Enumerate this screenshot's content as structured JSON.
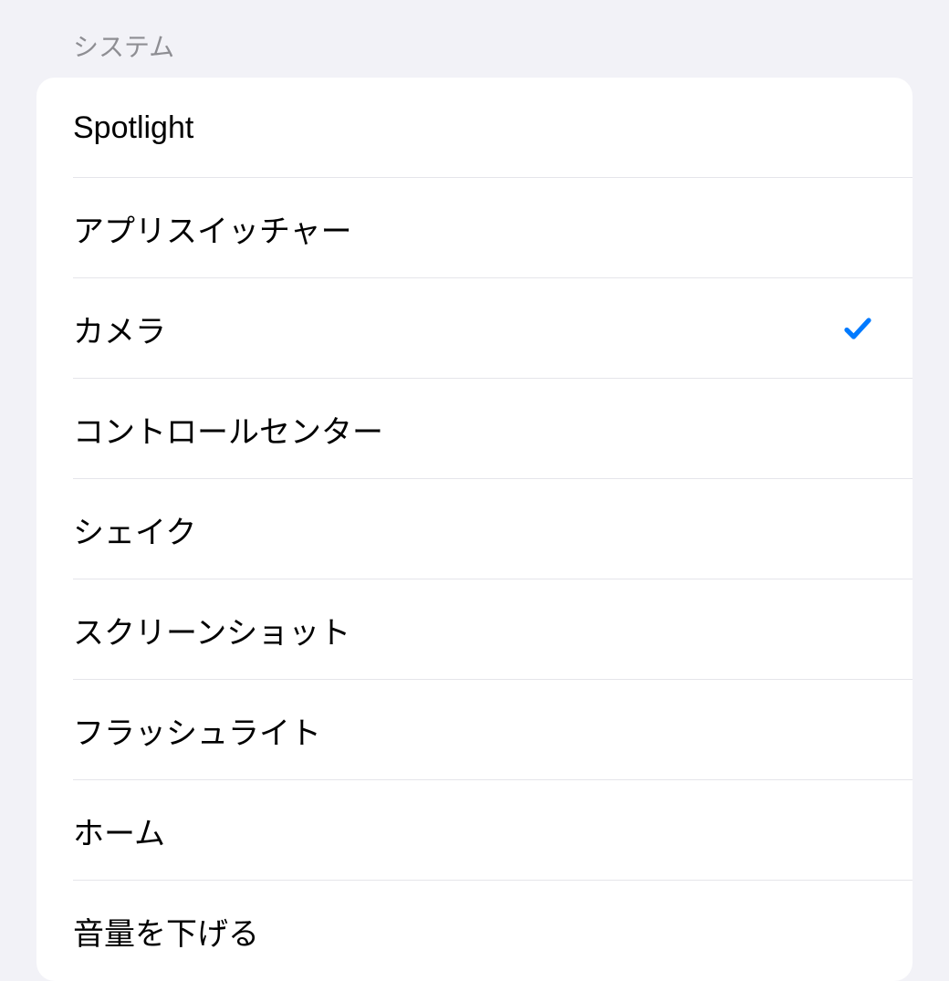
{
  "section": {
    "header": "システム",
    "items": [
      {
        "label": "Spotlight",
        "selected": false
      },
      {
        "label": "アプリスイッチャー",
        "selected": false
      },
      {
        "label": "カメラ",
        "selected": true
      },
      {
        "label": "コントロールセンター",
        "selected": false
      },
      {
        "label": "シェイク",
        "selected": false
      },
      {
        "label": "スクリーンショット",
        "selected": false
      },
      {
        "label": "フラッシュライト",
        "selected": false
      },
      {
        "label": "ホーム",
        "selected": false
      },
      {
        "label": "音量を下げる",
        "selected": false
      }
    ]
  },
  "colors": {
    "accent": "#007aff"
  }
}
